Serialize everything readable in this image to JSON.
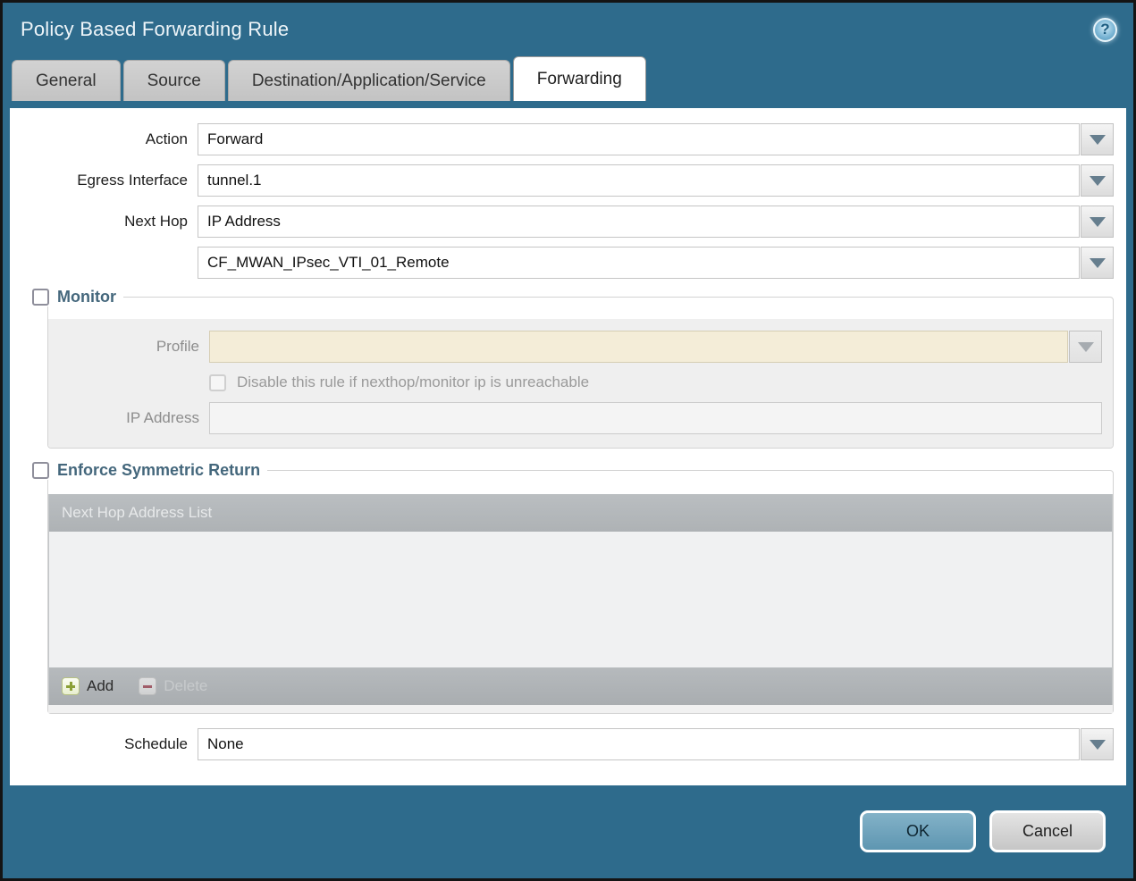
{
  "dialog": {
    "title": "Policy Based Forwarding Rule",
    "help_glyph": "?"
  },
  "tabs": [
    {
      "label": "General",
      "active": false
    },
    {
      "label": "Source",
      "active": false
    },
    {
      "label": "Destination/Application/Service",
      "active": false
    },
    {
      "label": "Forwarding",
      "active": true
    }
  ],
  "form": {
    "action": {
      "label": "Action",
      "value": "Forward"
    },
    "egress_interface": {
      "label": "Egress Interface",
      "value": "tunnel.1"
    },
    "next_hop": {
      "label": "Next Hop",
      "value": "IP Address"
    },
    "next_hop_address": {
      "value": "CF_MWAN_IPsec_VTI_01_Remote"
    },
    "schedule": {
      "label": "Schedule",
      "value": "None"
    }
  },
  "monitor": {
    "legend": "Monitor",
    "checked": false,
    "profile": {
      "label": "Profile",
      "value": ""
    },
    "disable_rule_label": "Disable this rule if nexthop/monitor ip is unreachable",
    "disable_rule_checked": false,
    "ip_address": {
      "label": "IP Address",
      "value": ""
    }
  },
  "symmetric_return": {
    "legend": "Enforce Symmetric Return",
    "checked": false,
    "table_header": "Next Hop Address List",
    "rows": [],
    "add_label": "Add",
    "delete_label": "Delete",
    "delete_enabled": false
  },
  "footer": {
    "ok_label": "OK",
    "cancel_label": "Cancel"
  },
  "colors": {
    "chrome_teal": "#2e6b8c",
    "active_tab": "#ffffff",
    "inactive_tab": "#c7c7c7",
    "beige_disabled_field": "#f4edd8",
    "table_gray": "#b2b6b9",
    "ok_button": "#6ea4be",
    "add_plus_green": "#8ba036",
    "delete_minus_red": "#9c4150"
  }
}
